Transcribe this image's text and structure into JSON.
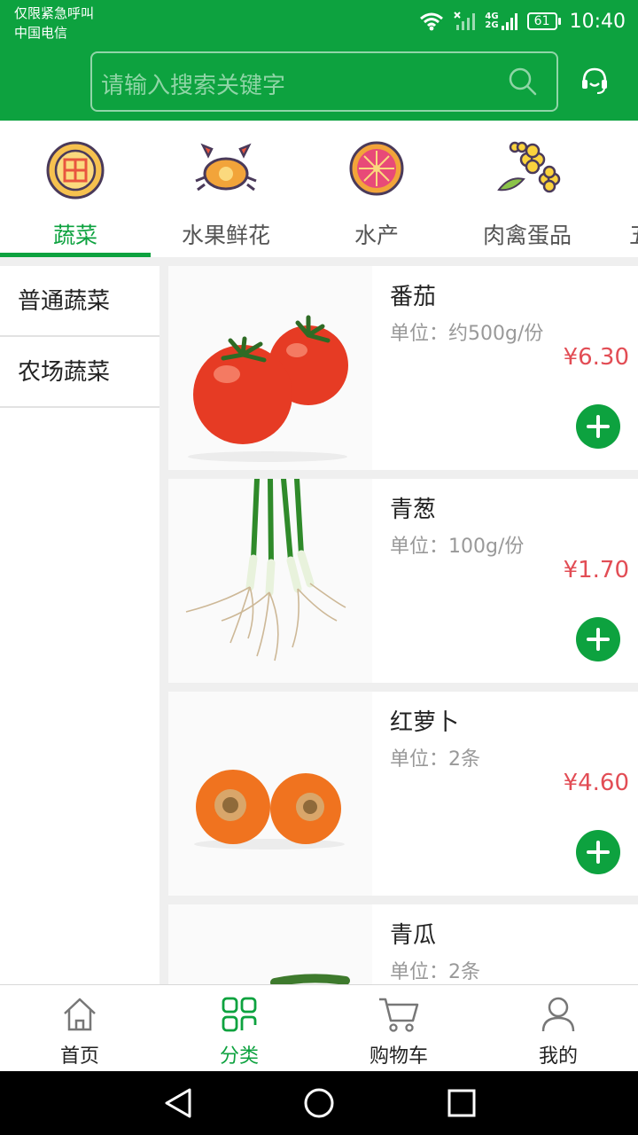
{
  "status_bar": {
    "line1": "仅限紧急呼叫",
    "line2": "中国电信",
    "network_top": "4G",
    "network_bottom": "2G",
    "battery": "61",
    "time": "10:40"
  },
  "search": {
    "placeholder": "请输入搜索关键字",
    "search_icon": "search-icon",
    "service_icon": "customer-service-icon"
  },
  "categories": [
    {
      "label": "蔬菜",
      "icon": "mooncake-icon",
      "active": true
    },
    {
      "label": "水果鲜花",
      "icon": "crab-icon",
      "active": false
    },
    {
      "label": "水产",
      "icon": "grapefruit-icon",
      "active": false
    },
    {
      "label": "肉禽蛋品",
      "icon": "flowers-icon",
      "active": false
    },
    {
      "label": "五",
      "icon": "",
      "active": false
    }
  ],
  "sidebar": {
    "items": [
      {
        "label": "普通蔬菜"
      },
      {
        "label": "农场蔬菜"
      }
    ]
  },
  "products": [
    {
      "name": "番茄",
      "unit": "单位：约500g/份",
      "price": "¥6.30"
    },
    {
      "name": "青葱",
      "unit": "单位：100g/份",
      "price": "¥1.70"
    },
    {
      "name": "红萝卜",
      "unit": "单位：2条",
      "price": "¥4.60"
    },
    {
      "name": "青瓜",
      "unit": "单位：2条",
      "price": ""
    }
  ],
  "bottom_nav": {
    "items": [
      {
        "label": "首页",
        "icon": "home-icon",
        "active": false
      },
      {
        "label": "分类",
        "icon": "category-icon",
        "active": true
      },
      {
        "label": "购物车",
        "icon": "cart-icon",
        "active": false
      },
      {
        "label": "我的",
        "icon": "user-icon",
        "active": false
      }
    ]
  },
  "colors": {
    "brand": "#0da23f",
    "price": "#e24d55"
  }
}
